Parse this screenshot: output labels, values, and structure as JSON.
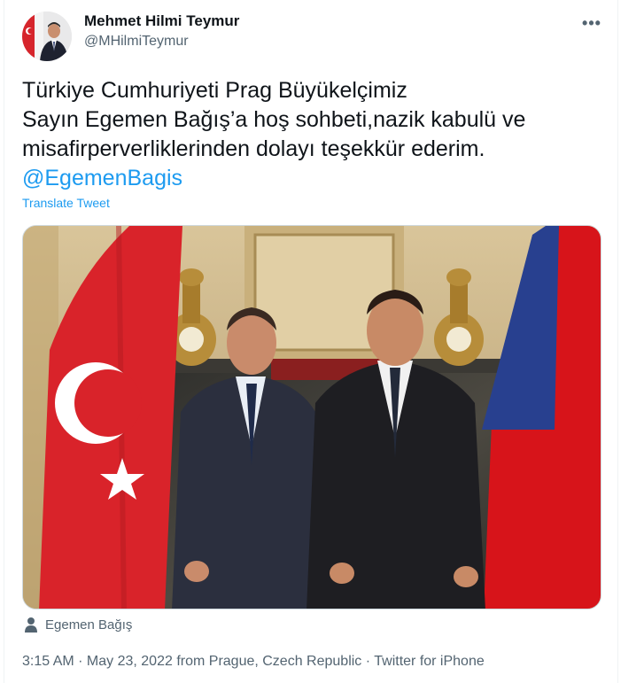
{
  "author": {
    "name": "Mehmet Hilmi Teymur",
    "handle": "@MHilmiTeymur"
  },
  "more_icon": "more-dots-icon",
  "tweet": {
    "lines": [
      "Türkiye Cumhuriyeti Prag Büyükelçimiz",
      "Sayın Egemen Bağış’a hoş sohbeti,nazik kabulü ve",
      "misafirperverliklerinden dolayı teşekkür ederim."
    ],
    "mention": "@EgemenBagis"
  },
  "translate_label": "Translate Tweet",
  "media": {
    "tagged_user": "Egemen Bağış",
    "tag_icon": "person-icon"
  },
  "meta": {
    "time": "3:15 AM",
    "sep1": " · ",
    "date": "May 23, 2022",
    "location": " from Prague, Czech Republic",
    "sep2": " · ",
    "source": "Twitter for iPhone"
  },
  "colors": {
    "link": "#1d9bf0",
    "secondary_text": "#536471",
    "primary_text": "#0f1419"
  }
}
